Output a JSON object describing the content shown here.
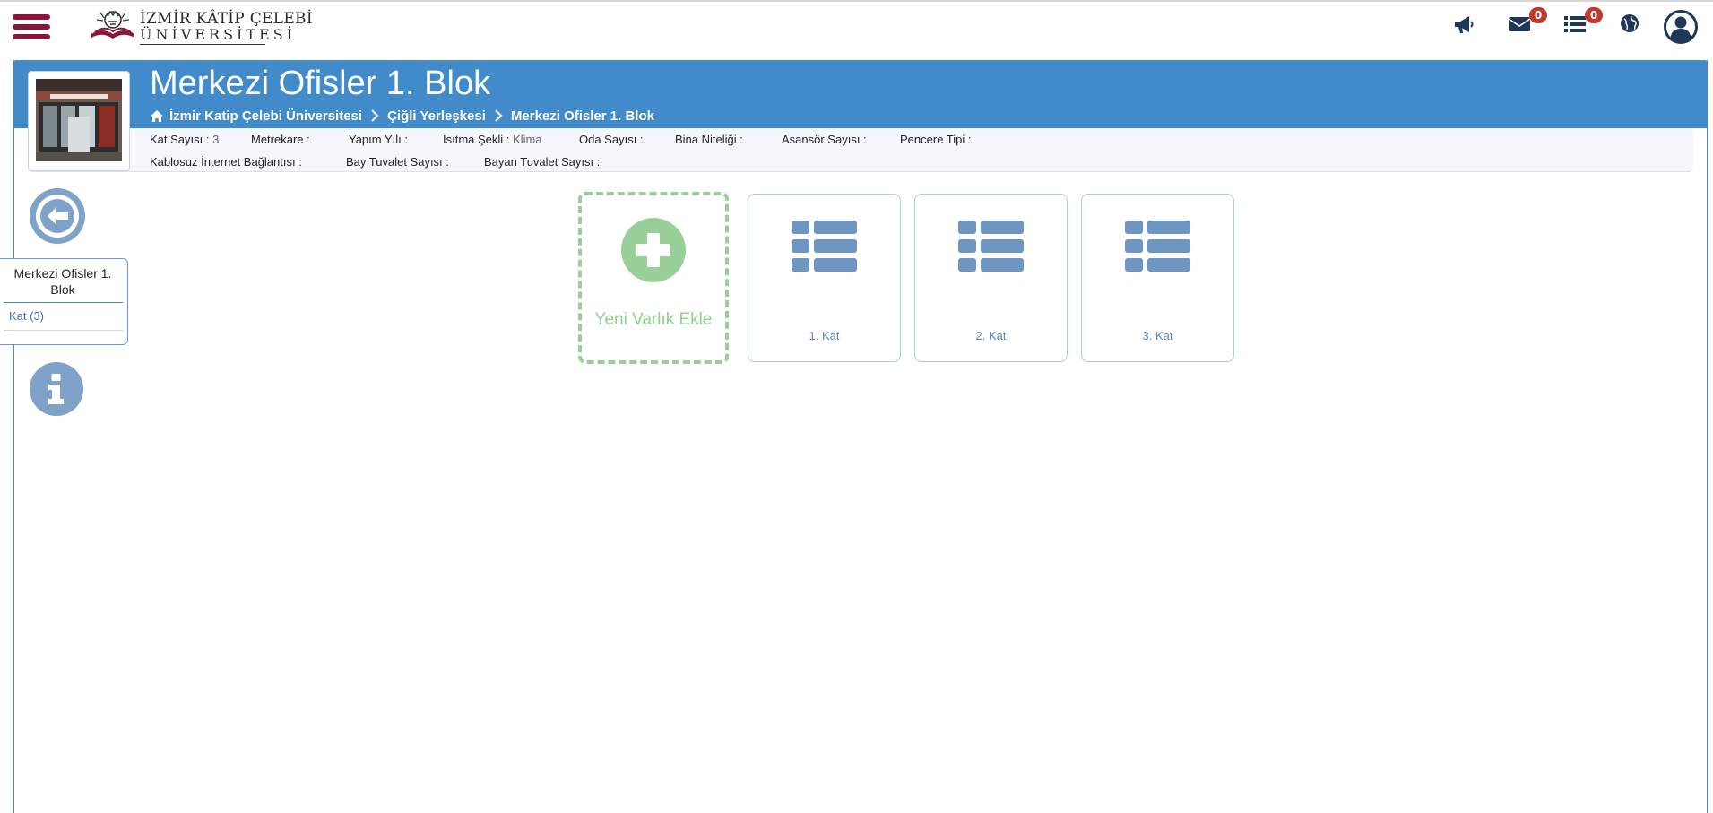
{
  "navbar": {
    "logo_line1": "İZMİR KÂTİP ÇELEBİ",
    "logo_line2": "ÜNİVERSİTESİ",
    "messages_count": "0",
    "tasks_count": "0",
    "accent_color": "#8a1538",
    "icons": [
      "menu-icon",
      "megaphone-icon",
      "envelope-icon",
      "list-icon",
      "globe-icon",
      "user-icon"
    ]
  },
  "header": {
    "title": "Merkezi Ofisler 1. Blok",
    "breadcrumb": [
      "İzmir Katip Çelebi Üniversitesi",
      "Çiğli Yerleşkesi",
      "Merkezi Ofisler 1. Blok"
    ],
    "band_color": "#428bca"
  },
  "info": {
    "row1": [
      {
        "label": "Kat Sayısı :",
        "value": "3"
      },
      {
        "label": "Metrekare :",
        "value": ""
      },
      {
        "label": "Yapım Yılı :",
        "value": ""
      },
      {
        "label": "Isıtma Şekli :",
        "value": "Klima"
      },
      {
        "label": "Oda Sayısı :",
        "value": ""
      },
      {
        "label": "Bina Niteliği :",
        "value": ""
      },
      {
        "label": "Asansör Sayısı :",
        "value": ""
      },
      {
        "label": "Pencere Tipi :",
        "value": ""
      }
    ],
    "row2": [
      {
        "label": "Kablosuz İnternet Bağlantısı :",
        "value": ""
      },
      {
        "label": "Bay Tuvalet Sayısı :",
        "value": ""
      },
      {
        "label": "Bayan Tuvalet Sayısı :",
        "value": ""
      }
    ]
  },
  "sidebar": {
    "title": "Merkezi Ofisler 1. Blok",
    "items": [
      {
        "label": "Kat (3)"
      }
    ]
  },
  "tiles": {
    "add_label": "Yeni Varlık Ekle",
    "add_color": "#99d09a",
    "floors": [
      {
        "label": "1. Kat"
      },
      {
        "label": "2. Kat"
      },
      {
        "label": "3. Kat"
      }
    ],
    "floor_icon_color": "#6e96c2"
  }
}
